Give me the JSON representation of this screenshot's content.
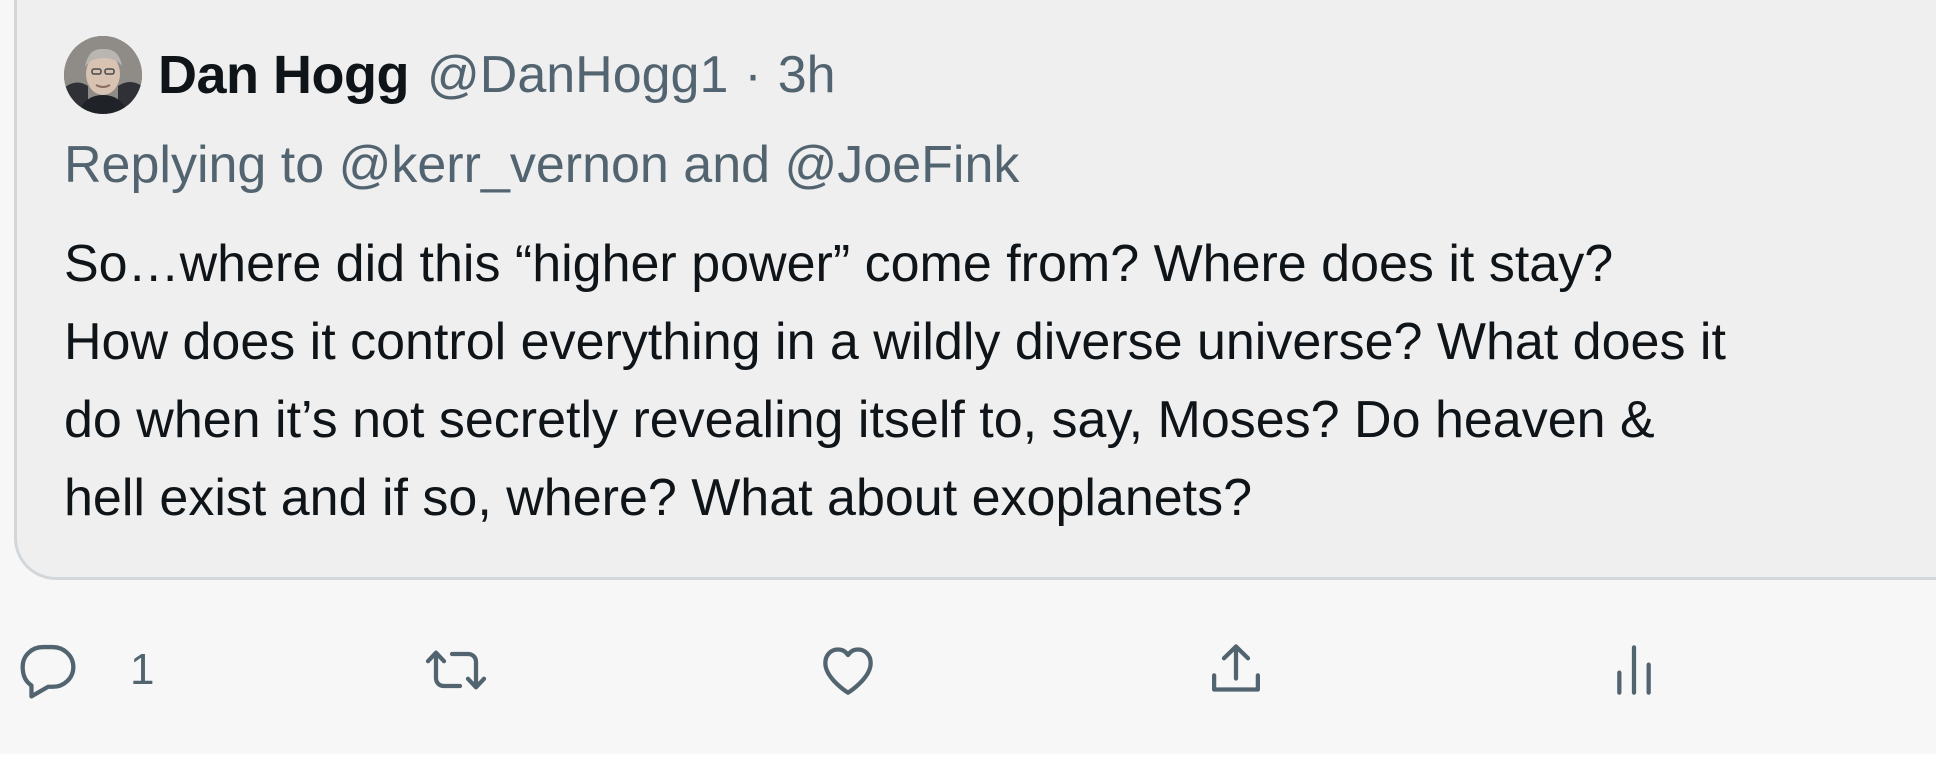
{
  "tweet": {
    "author_name": "Dan Hogg",
    "author_handle": "@DanHogg1",
    "separator": "·",
    "time": "3h",
    "replying_to": "Replying to @kerr_vernon and @JoeFink",
    "text_lines": [
      "So…where did this “higher power” come from? Where does it stay?",
      "How does it control everything in a wildly diverse universe? What does it",
      "do when it’s not secretly revealing itself to, say, Moses? Do heaven &",
      "hell exist and if so, where? What about exoplanets?"
    ]
  },
  "actions": {
    "reply": {
      "icon": "reply-icon",
      "count": "1"
    },
    "retweet": {
      "icon": "retweet-icon"
    },
    "like": {
      "icon": "heart-icon"
    },
    "share": {
      "icon": "share-icon"
    },
    "analytics": {
      "icon": "analytics-icon"
    }
  },
  "colors": {
    "primary_text": "#0f1419",
    "secondary_text": "#536471",
    "card_background": "#efefef",
    "card_border": "#d2d7db",
    "page_background": "#f7f7f7"
  }
}
